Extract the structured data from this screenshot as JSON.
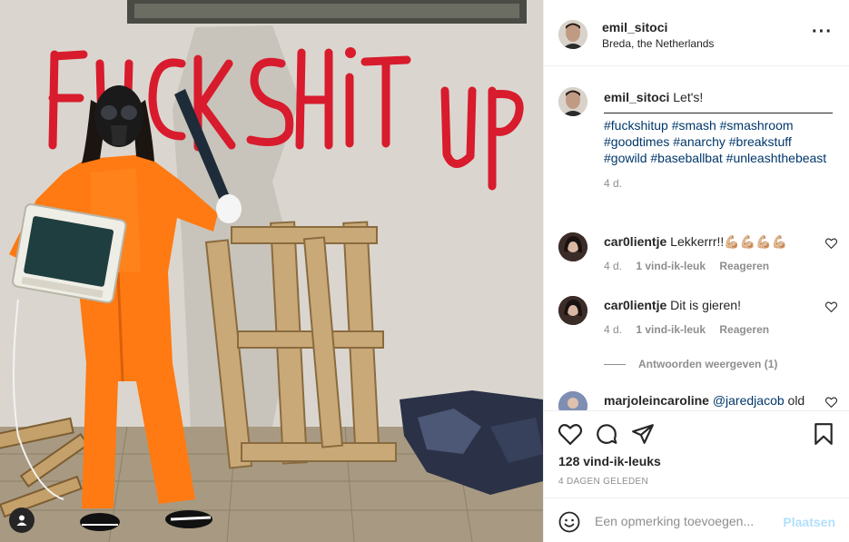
{
  "photo": {
    "graffiti": "FUCK SHiT UP"
  },
  "header": {
    "username": "emil_sitoci",
    "location": "Breda, the Netherlands",
    "more_icon": "more-horizontal-icon"
  },
  "caption": {
    "username": "emil_sitoci",
    "text": "Let's!",
    "tags": "#fuckshitup #smash #smashroom #goodtimes #anarchy #breakstuff #gowild #baseballbat #unleashthebeast",
    "time": "4 d."
  },
  "comments": [
    {
      "username": "car0lientje",
      "text": "Lekkerrr!!💪🏼💪🏼💪🏼💪🏼",
      "time": "4 d.",
      "likes": "1 vind-ik-leuk",
      "reply": "Reageren"
    },
    {
      "username": "car0lientje",
      "text": "Dit is gieren!",
      "time": "4 d.",
      "likes": "1 vind-ik-leuk",
      "reply": "Reageren"
    },
    {
      "username": "marjoleincaroline",
      "mention": "@jaredjacob",
      "text": "old"
    }
  ],
  "view_replies": "Antwoorden weergeven (1)",
  "actions": {
    "like_icon": "heart-icon",
    "comment_icon": "comment-icon",
    "share_icon": "paper-plane-icon",
    "save_icon": "bookmark-icon"
  },
  "likes": "128 vind-ik-leuks",
  "posted": "4 DAGEN GELEDEN",
  "add_comment": {
    "placeholder": "Een opmerking toevoegen...",
    "post_label": "Plaatsen",
    "emoji_icon": "smiley-icon"
  },
  "colors": {
    "text": "#262626",
    "muted": "#8e8e8e",
    "link": "#00376b",
    "post_disabled": "#b2dffc",
    "graffiti": "#d81b2d",
    "jumpsuit": "#ff7a12"
  }
}
